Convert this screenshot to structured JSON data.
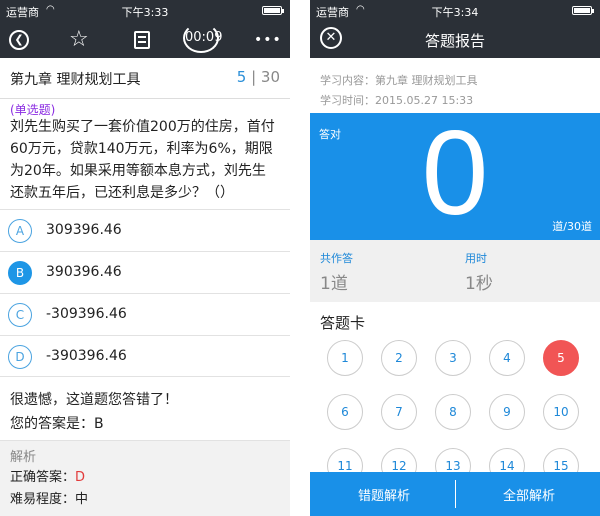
{
  "left": {
    "status": {
      "carrier": "运营商",
      "time": "下午3:33"
    },
    "toolbar": {
      "timer": "00:09"
    },
    "chapter": {
      "title": "第九章 理财规划工具",
      "current": "5",
      "separator": "|",
      "total": "30"
    },
    "question": {
      "type": "(单选题)",
      "lines": [
        "刘先生购买了一套价值200万的住房，首付",
        "60万元，贷款140万元，利率为6%，期限",
        "为20年。如果采用等额本息方式，刘先生",
        "还款五年后，已还利息是多少？（）"
      ]
    },
    "options": [
      {
        "letter": "A",
        "text": "309396.46",
        "selected": false
      },
      {
        "letter": "B",
        "text": "390396.46",
        "selected": true
      },
      {
        "letter": "C",
        "text": "-309396.46",
        "selected": false
      },
      {
        "letter": "D",
        "text": "-390396.46",
        "selected": false
      }
    ],
    "feedback": {
      "message": "很遗憾，这道题您答错了！",
      "your_answer_label": "您的答案是：",
      "your_answer": "B"
    },
    "analysis": {
      "heading": "解析",
      "correct_label": "正确答案：",
      "correct": "D",
      "difficulty_label": "难易程度：",
      "difficulty": "中"
    }
  },
  "right": {
    "status": {
      "carrier": "运营商",
      "time": "下午3:34"
    },
    "title": "答题报告",
    "content_line": "学习内容：第九章 理财规划工具",
    "time_line": "学习时间：2015.05.27 15:33",
    "score": {
      "label": "答对",
      "value": "0",
      "unit": "道/30道"
    },
    "stats": {
      "answered_label": "共作答",
      "answered": "1道",
      "time_label": "用时",
      "time": "1秒"
    },
    "card_title": "答题卡",
    "numbers": [
      {
        "n": "1",
        "wrong": false
      },
      {
        "n": "2",
        "wrong": false
      },
      {
        "n": "3",
        "wrong": false
      },
      {
        "n": "4",
        "wrong": false
      },
      {
        "n": "5",
        "wrong": true
      },
      {
        "n": "6",
        "wrong": false
      },
      {
        "n": "7",
        "wrong": false
      },
      {
        "n": "8",
        "wrong": false
      },
      {
        "n": "9",
        "wrong": false
      },
      {
        "n": "10",
        "wrong": false
      },
      {
        "n": "11",
        "wrong": false
      },
      {
        "n": "12",
        "wrong": false
      },
      {
        "n": "13",
        "wrong": false
      },
      {
        "n": "14",
        "wrong": false
      },
      {
        "n": "15",
        "wrong": false
      }
    ],
    "buttons": {
      "wrong_analysis": "错题解析",
      "all_analysis": "全部解析"
    }
  },
  "colors": {
    "navbar": "#2b3037",
    "accent": "#1990e8",
    "wrong": "#f15555",
    "question_type": "#8a2be2"
  },
  "icons": [
    "back-icon",
    "star-icon",
    "answer-card-icon",
    "timer-icon",
    "more-icon",
    "close-icon",
    "wifi-icon",
    "battery-icon"
  ]
}
